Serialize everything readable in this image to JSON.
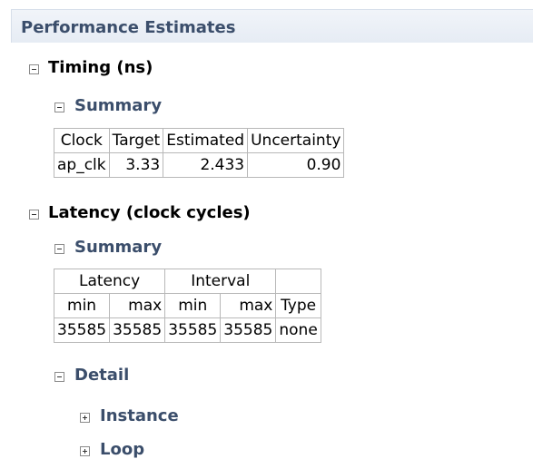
{
  "header": {
    "title": "Performance Estimates"
  },
  "timing": {
    "title": "Timing (ns)",
    "summary_title": "Summary",
    "columns": [
      "Clock",
      "Target",
      "Estimated",
      "Uncertainty"
    ],
    "rows": [
      {
        "clock": "ap_clk",
        "target": "3.33",
        "estimated": "2.433",
        "uncertainty": "0.90"
      }
    ]
  },
  "latency": {
    "title": "Latency (clock cycles)",
    "summary_title": "Summary",
    "group_headers": {
      "latency": "Latency",
      "interval": "Interval"
    },
    "columns": [
      "min",
      "max",
      "min",
      "max",
      "Type"
    ],
    "rows": [
      {
        "lat_min": "35585",
        "lat_max": "35585",
        "int_min": "35585",
        "int_max": "35585",
        "type": "none"
      }
    ],
    "detail": {
      "title": "Detail",
      "items": [
        {
          "label": "Instance"
        },
        {
          "label": "Loop"
        }
      ]
    }
  }
}
